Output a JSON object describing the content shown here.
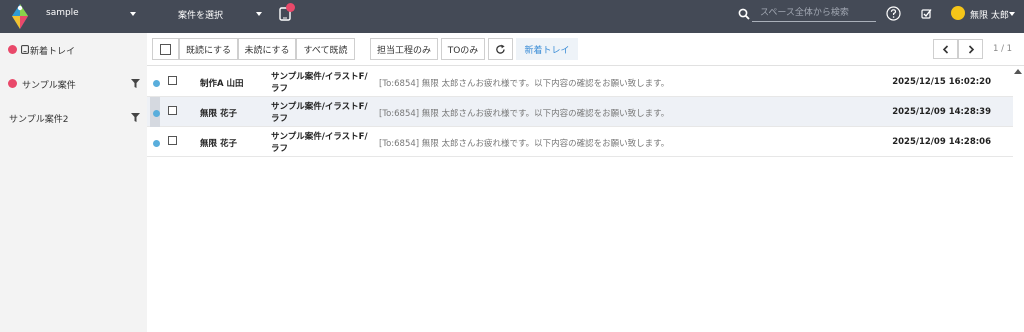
{
  "header": {
    "workspace": "sample",
    "project_select": "案件を選択",
    "search_placeholder": "スペース全体から検索",
    "user_name": "無限 太郎"
  },
  "sidebar": {
    "items": [
      {
        "label": "新着トレイ"
      },
      {
        "label": "サンプル案件"
      },
      {
        "label": "サンプル案件2"
      }
    ]
  },
  "toolbar": {
    "mark_read": "既読にする",
    "mark_unread": "未読にする",
    "mark_all_read": "すべて既読",
    "assigned_only": "担当工程のみ",
    "to_only": "TOのみ",
    "inbox_tab": "新着トレイ",
    "page_count": "1 / 1"
  },
  "messages": [
    {
      "sender": "制作A 山田",
      "subject_line1": "サンプル案件/イラストF/",
      "subject_line2": "ラフ",
      "preview": "[To:6854] 無限 太郎さんお疲れ様です。以下内容の確認をお願い致します。",
      "date": "2025/12/15 16:02:20"
    },
    {
      "sender": "無限 花子",
      "subject_line1": "サンプル案件/イラストF/",
      "subject_line2": "ラフ",
      "preview": "[To:6854] 無限 太郎さんお疲れ様です。以下内容の確認をお願い致します。",
      "date": "2025/12/09 14:28:39"
    },
    {
      "sender": "無限 花子",
      "subject_line1": "サンプル案件/イラストF/",
      "subject_line2": "ラフ",
      "preview": "[To:6854] 無限 太郎さんお疲れ様です。以下内容の確認をお願い致します。",
      "date": "2025/12/09 14:28:06"
    }
  ],
  "colors": {
    "topbar": "#444a56",
    "accent_pink": "#e9496a",
    "unread_blue": "#59aedc",
    "link_blue": "#3a8cd6"
  }
}
